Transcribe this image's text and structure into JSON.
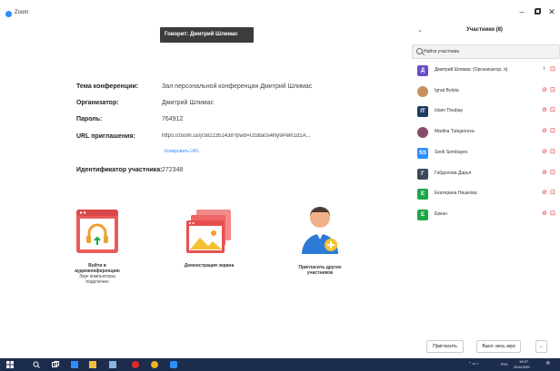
{
  "window": {
    "app_title": "Zoom",
    "controls": {
      "minimize": "–",
      "restore": "▫",
      "close": "✕"
    }
  },
  "speaking_banner": "Говорит: Дмитрий Шлимас",
  "meeting_info": {
    "topic_label": "Тема конференции:",
    "topic_value": "Зал персональной конференции Дмитрий Шлимас",
    "host_label": "Организатор:",
    "host_value": "Дмитрий Шлимас",
    "password_label": "Пароль:",
    "password_value": "764912",
    "url_label": "URL приглашения:",
    "url_value": "https://zoom.us/j/3822351438?pwd=Uzdta0s4Ny9Pelh1d1A...",
    "copy_url": "Копировать URL",
    "participant_id_label": "Идентификатор участника:",
    "participant_id_value": "272348"
  },
  "actions": {
    "audio_label_1": "Войти в",
    "audio_label_2": "аудиоконференцию",
    "audio_sub_1": "Звук компьютера",
    "audio_sub_2": "подключен",
    "share_label": "Демонстрация экрана",
    "invite_label_1": "Пригласить других",
    "invite_label_2": "участников"
  },
  "participants_panel": {
    "title": "Участники (8)",
    "search_placeholder": "Найти участника",
    "participants": [
      {
        "initial": "Д",
        "name": "Дмитрий Шлимас (Организатор, я)",
        "color": "#6a4fc8",
        "mic": "🎙",
        "cam": ""
      },
      {
        "initial": "",
        "name": "Ignat Bolota",
        "color": "#c89060",
        "mic": "🎙",
        "cam": ""
      },
      {
        "initial": "IT",
        "name": "Islam Tleubay",
        "color": "#1e3a5f",
        "mic": "🎙",
        "cam": ""
      },
      {
        "initial": "",
        "name": "Madina Tulegenova",
        "color": "#8a4a6a",
        "mic": "🎙",
        "cam": ""
      },
      {
        "initial": "SS",
        "name": "Serik Sembayev",
        "color": "#2d8cff",
        "mic": "🎙",
        "cam": ""
      },
      {
        "initial": "Г",
        "name": "Габдолова Дарья",
        "color": "#3a4a5a",
        "mic": "🎙",
        "cam": ""
      },
      {
        "initial": "Е",
        "name": "Екатерина Нашкова",
        "color": "#1fa64a",
        "mic": "🎙",
        "cam": ""
      },
      {
        "initial": "Е",
        "name": "Еркан",
        "color": "#1fa64a",
        "mic": "🎙",
        "cam": ""
      }
    ],
    "invite_button": "Пригласить",
    "mute_all_button": "Выкл. весь звук",
    "more_button": "..."
  },
  "taskbar": {
    "lang": "РУС",
    "time": "15:27",
    "date": "15.04.2020"
  },
  "colors": {
    "accent": "#2d8cff",
    "audio_icon": "#e85c5c",
    "share_icon": "#f06565",
    "invite_icon": "#2d7bd6",
    "muted": "#e02828",
    "taskbar": "#1c2c4c"
  }
}
